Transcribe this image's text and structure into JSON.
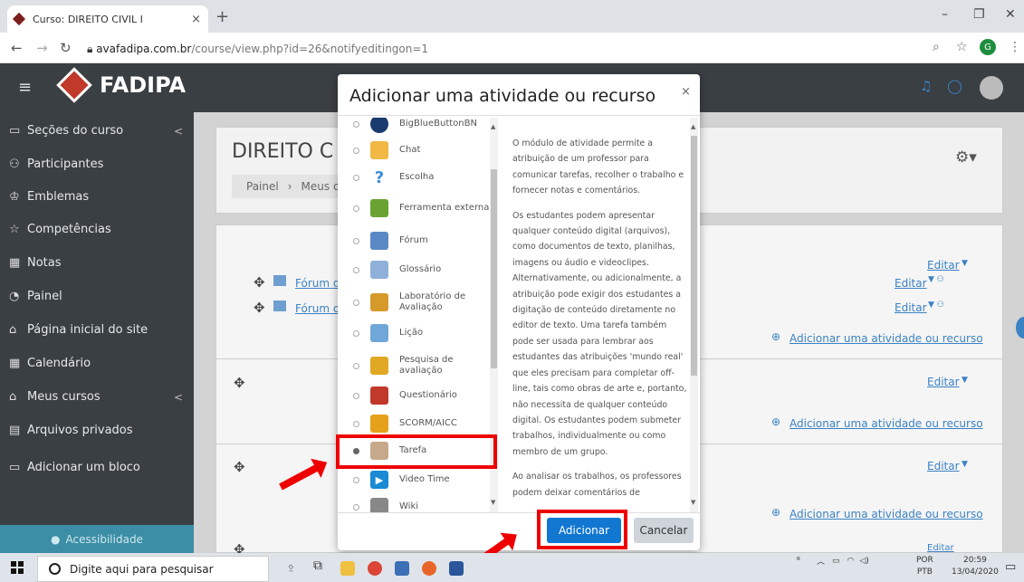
{
  "browser": {
    "tab_title": "Curso: DIREITO CIVIL I",
    "tab_close": "×",
    "new_tab": "+",
    "url_host": "avafadipa.com.br",
    "url_path": "/course/view.php?id=26&notifyeditingon=1",
    "profile_initial": "G"
  },
  "app": {
    "logo_text": "FADIPA"
  },
  "sidebar": {
    "items": [
      {
        "label": "Seções do curso"
      },
      {
        "label": "Participantes"
      },
      {
        "label": "Emblemas"
      },
      {
        "label": "Competências"
      },
      {
        "label": "Notas"
      },
      {
        "label": "Painel"
      },
      {
        "label": "Página inicial do site"
      },
      {
        "label": "Calendário"
      },
      {
        "label": "Meus cursos"
      },
      {
        "label": "Arquivos privados"
      },
      {
        "label": "Adicionar um bloco"
      }
    ],
    "accessibility": "Acessibilidade"
  },
  "course": {
    "title": "DIREITO C",
    "breadcrumb_1": "Painel",
    "breadcrumb_2": "Meus c",
    "forum_1": "Fórum d",
    "forum_2": "Fórum d",
    "edit": "Editar",
    "add_activity": "Adicionar uma atividade ou recurso"
  },
  "modal": {
    "title": "Adicionar uma atividade ou recurso",
    "close": "×",
    "items": [
      {
        "label": "BigBlueButtonBN",
        "color": "#1a3b6e"
      },
      {
        "label": "Chat",
        "color": "#f1b844"
      },
      {
        "label": "Escolha",
        "color": "#3b8ed8"
      },
      {
        "label": "Ferramenta externa",
        "color": "#6aa331"
      },
      {
        "label": "Fórum",
        "color": "#5a88c5"
      },
      {
        "label": "Glossário",
        "color": "#8fb1d9"
      },
      {
        "label": "Laboratório de Avaliação",
        "color": "#d69a2b"
      },
      {
        "label": "Lição",
        "color": "#6fa7d8"
      },
      {
        "label": "Pesquisa de avaliação",
        "color": "#e0a823"
      },
      {
        "label": "Questionário",
        "color": "#c0392b"
      },
      {
        "label": "SCORM/AICC",
        "color": "#e6a11a"
      },
      {
        "label": "Tarefa",
        "color": "#c6a98a"
      },
      {
        "label": "Video Time",
        "color": "#1a8ad4"
      },
      {
        "label": "Wiki",
        "color": "#888888"
      }
    ],
    "help_p1": "O módulo de atividade permite a atribuição de um professor para comunicar tarefas, recolher o trabalho e fornecer notas e comentários.",
    "help_p2": "Os estudantes podem apresentar qualquer conteúdo digital (arquivos), como documentos de texto, planilhas, imagens ou áudio e videoclipes. Alternativamente, ou adicionalmente, a atribuição pode exigir dos estudantes a digitação de conteúdo diretamente no editor de texto. Uma tarefa também pode ser usada para lembrar aos estudantes das atribuições 'mundo real' que eles precisam para completar off-line, tais como obras de arte e, portanto, não necessita de qualquer conteúdo digital. Os estudantes podem submeter trabalhos, individualmente ou como membro de um grupo.",
    "help_p3": "Ao analisar os trabalhos, os professores podem deixar comentários de",
    "add_button": "Adicionar",
    "cancel_button": "Cancelar"
  },
  "taskbar": {
    "search_placeholder": "Digite aqui para pesquisar",
    "lang_1": "POR",
    "lang_2": "PTB",
    "time": "20:59",
    "date": "13/04/2020"
  }
}
